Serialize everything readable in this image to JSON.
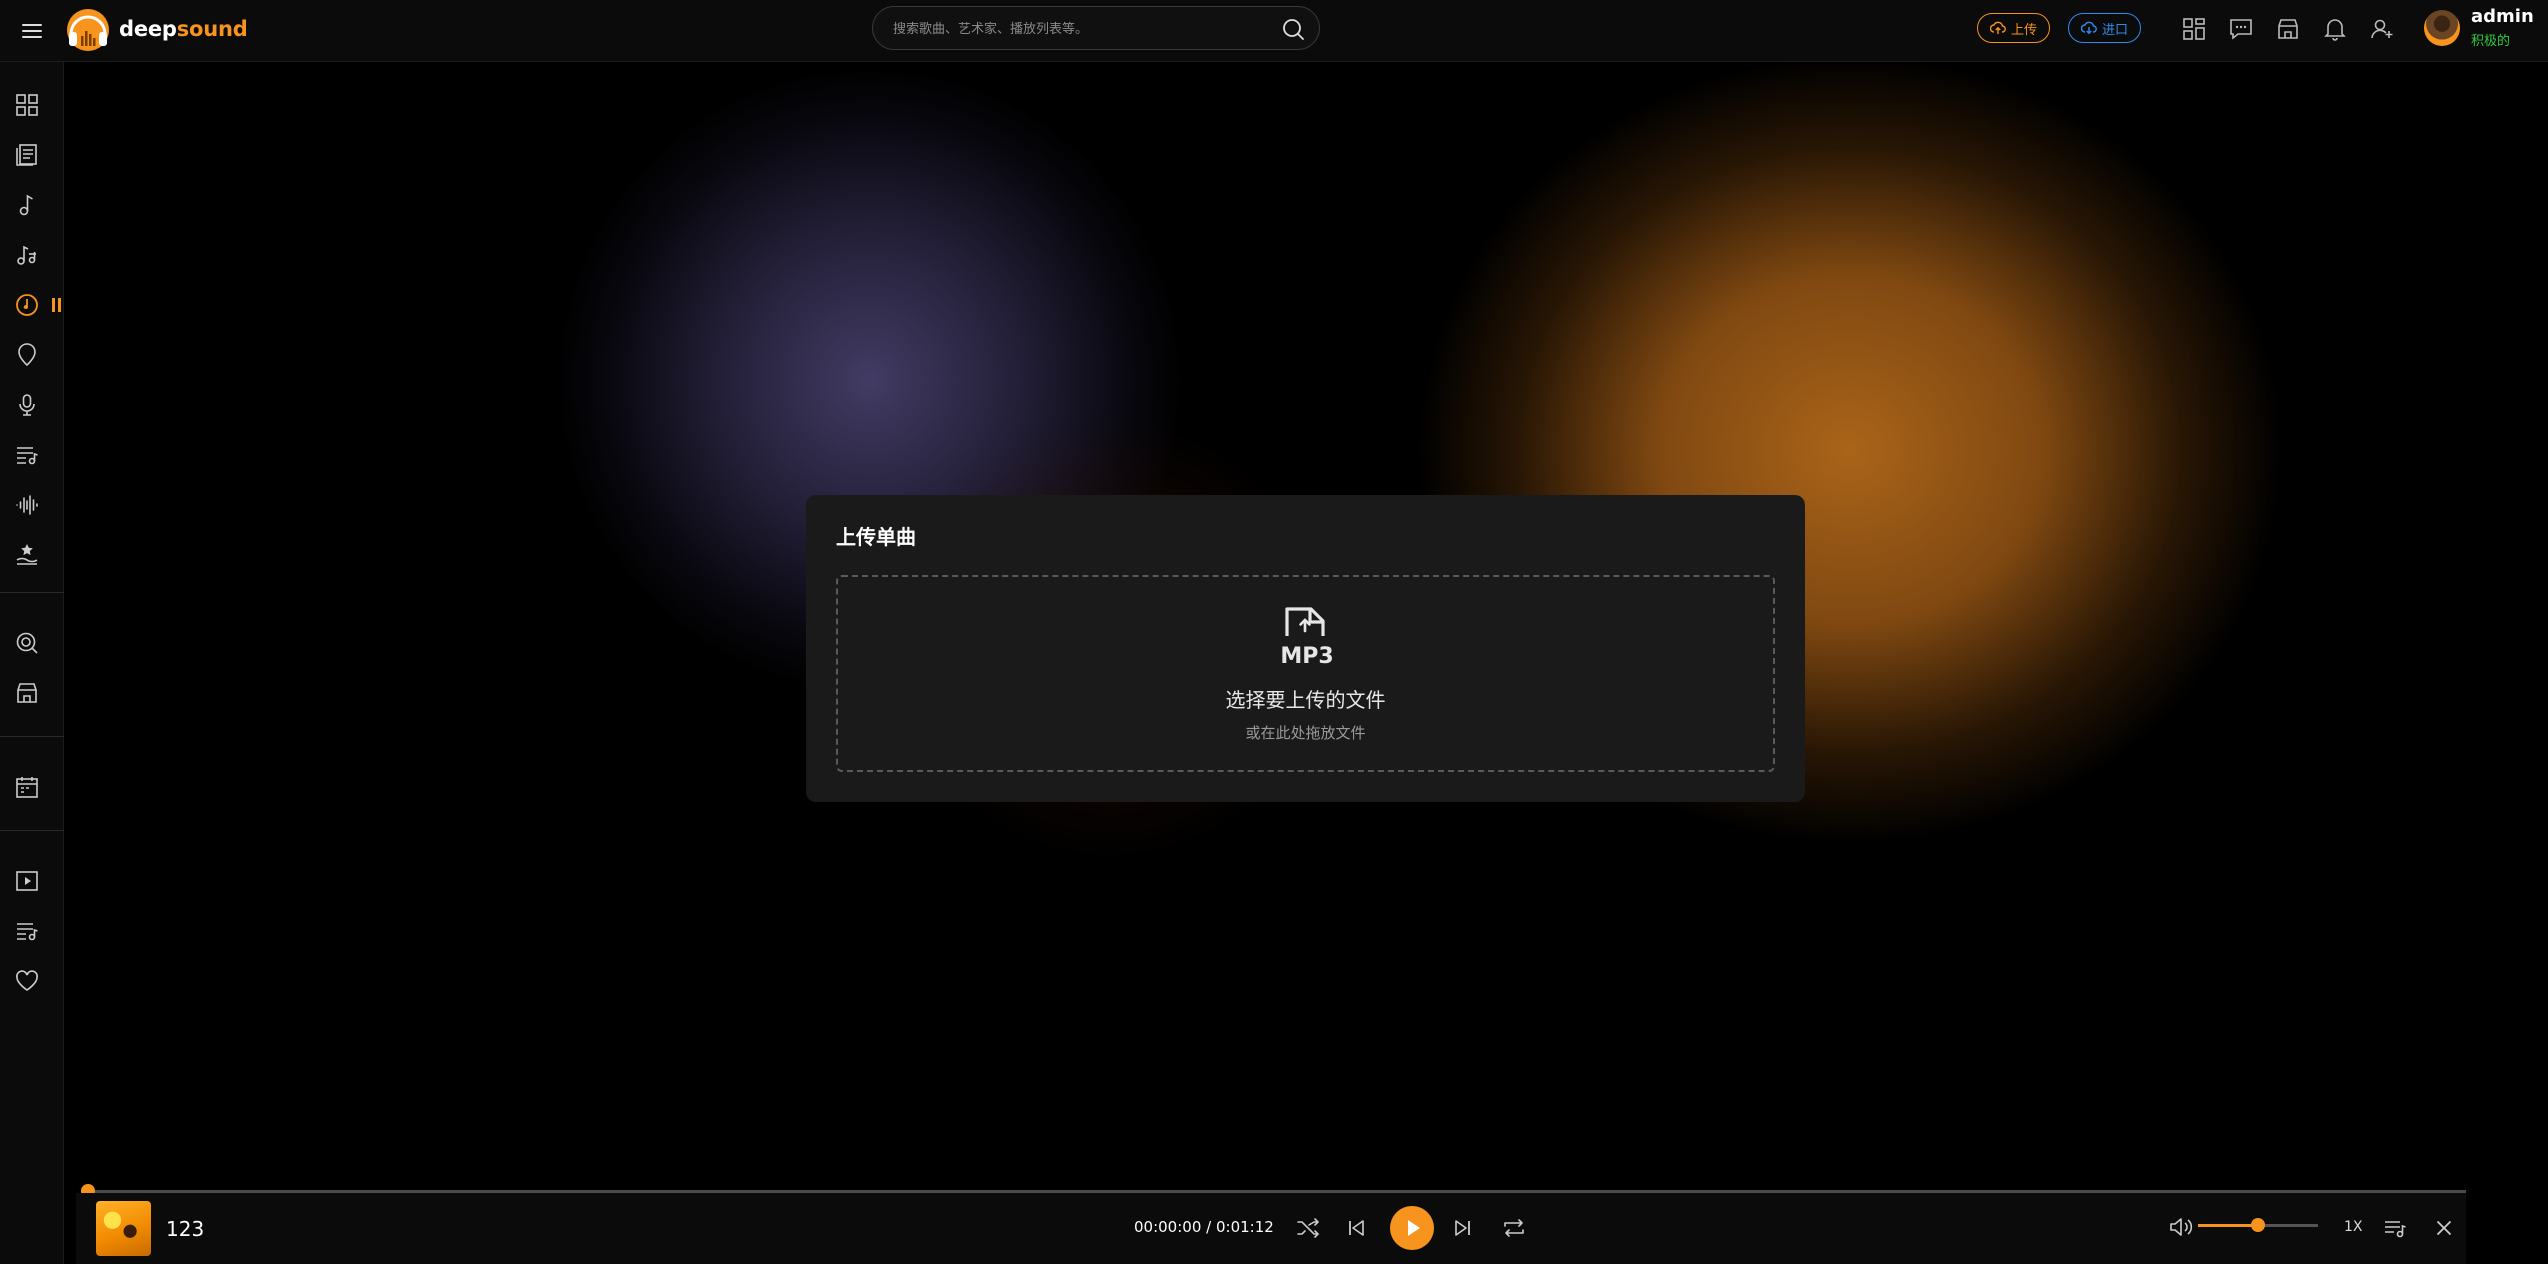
{
  "app": {
    "brand_part1": "deep",
    "brand_part2": "sound"
  },
  "header": {
    "search_placeholder": "搜索歌曲、艺术家、播放列表等。",
    "upload_label": "上传",
    "import_label": "进口",
    "icons": [
      "grid-icon",
      "chat-icon",
      "shop-icon",
      "bell-icon",
      "add-user-icon"
    ],
    "user": {
      "name": "admin",
      "role": "积极的"
    }
  },
  "sidebar": {
    "items": [
      "dashboard-icon",
      "documents-icon",
      "music-note-icon",
      "music-notes-icon",
      "now-playing-disc-icon",
      "location-icon",
      "microphone-icon",
      "playlist-icon",
      "waveform-icon",
      "featured-icon",
      "discover-icon",
      "store-icon",
      "calendar-icon",
      "video-play-icon",
      "queue-icon",
      "heart-icon"
    ],
    "active": "now-playing-disc-icon"
  },
  "modal": {
    "title": "上传单曲",
    "file_type_badge": "MP3",
    "dropzone_text": "选择要上传的文件",
    "dropzone_subtext": "或在此处拖放文件"
  },
  "player": {
    "track_title": "123",
    "current_time": "00:00:00",
    "separator": " / ",
    "duration": "0:01:12",
    "progress_fraction": 0.0,
    "volume_fraction": 0.5,
    "speed": "1X"
  },
  "colors": {
    "accent": "#f7941d",
    "import_blue": "#2d8cf0",
    "status_green": "#2ecc40",
    "background": "#000000",
    "panel": "#1a1a1a"
  }
}
